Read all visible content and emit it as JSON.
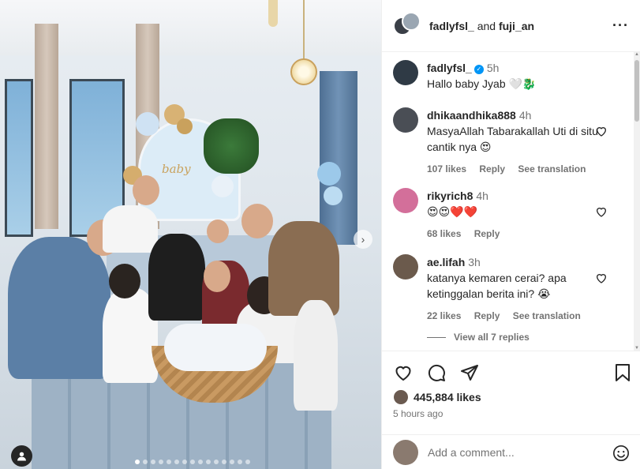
{
  "header": {
    "user1": "fadlyfsl_",
    "and_label": "and",
    "user2": "fuji_an",
    "more_icon": "more-horizontal-icon"
  },
  "caption": {
    "username": "fadlyfsl_",
    "verified": true,
    "time": "5h",
    "text": "Hallo baby Jyab 🤍🐉"
  },
  "comments": [
    {
      "username": "dhikaandhika888",
      "time": "4h",
      "text": "MasyaAllah Tabarakallah Uti di situ cantik nya 😍",
      "likes": "107 likes",
      "reply": "Reply",
      "translation": "See translation"
    },
    {
      "username": "rikyrich8",
      "time": "4h",
      "text": "😍😍❤️❤️",
      "likes": "68 likes",
      "reply": "Reply"
    },
    {
      "username": "ae.lifah",
      "time": "3h",
      "text": "katanya kemaren cerai? apa ketinggalan berita ini? 😭",
      "likes": "22 likes",
      "reply": "Reply",
      "translation": "See translation"
    }
  ],
  "view_replies": "View all 7 replies",
  "actions": {
    "like_icon": "heart-icon",
    "comment_icon": "comment-icon",
    "share_icon": "send-icon",
    "save_icon": "bookmark-icon"
  },
  "likes_count": "445,884 likes",
  "posted_time": "5 hours ago",
  "add_comment": {
    "placeholder": "Add a comment..."
  },
  "carousel": {
    "total": 15,
    "active": 0
  },
  "colors": {
    "verified": "#0095f6",
    "text": "#262626",
    "secondary": "#737373",
    "border": "#efefef"
  }
}
